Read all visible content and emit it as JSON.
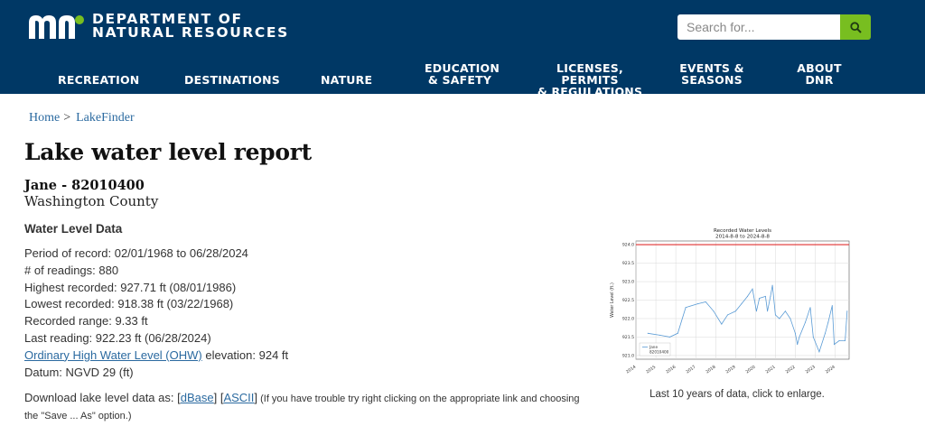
{
  "header": {
    "logo_line1": "DEPARTMENT OF",
    "logo_line2": "NATURAL RESOURCES",
    "search_placeholder": "Search for...",
    "nav": [
      "RECREATION",
      "DESTINATIONS",
      "NATURE",
      "EDUCATION\n& SAFETY",
      "LICENSES, PERMITS\n& REGULATIONS",
      "EVENTS &\nSEASONS",
      "ABOUT\nDNR"
    ]
  },
  "breadcrumb": {
    "home": "Home",
    "sep": ">",
    "current": "LakeFinder"
  },
  "page": {
    "title": "Lake water level report",
    "lake": "Jane - 82010400",
    "county": "Washington County",
    "section_title": "Water Level Data"
  },
  "stats": {
    "period": "Period of record: 02/01/1968 to 06/28/2024",
    "readings": "# of readings: 880",
    "highest": "Highest recorded: 927.71 ft (08/01/1986)",
    "lowest": "Lowest recorded: 918.38 ft (03/22/1968)",
    "range": "Recorded range: 9.33 ft",
    "last": "Last reading: 922.23 ft (06/28/2024)",
    "ohw_link": "Ordinary High Water Level (OHW)",
    "ohw_rest": " elevation: 924 ft",
    "datum": "Datum: NGVD 29 (ft)"
  },
  "download": {
    "prefix": "Download lake level data as: ",
    "dbase": "dBase",
    "ascii": "ASCII",
    "note": " (If you have trouble try right clicking on the appropriate link and choosing the \"Save ... As\" option.)"
  },
  "caption": "Last 10 years of data, click to enlarge.",
  "chart_data": {
    "type": "line",
    "title": "Recorded Water Levels",
    "subtitle": "2014-8-8 to 2024-8-8",
    "ylabel": "Water Level (ft.)",
    "xlabel": "",
    "ylim": [
      920.9,
      924.1
    ],
    "xlim": [
      2014.0,
      2024.7
    ],
    "x_ticks": [
      "2014",
      "2015",
      "2016",
      "2017",
      "2018",
      "2019",
      "2020",
      "2021",
      "2022",
      "2023",
      "2024"
    ],
    "y_ticks": [
      "921.0",
      "921.5",
      "922.0",
      "922.5",
      "923.0",
      "923.5",
      "924.0"
    ],
    "grid": true,
    "legend": {
      "position": "bottom-left",
      "entries": [
        "Jane",
        "82010400"
      ]
    },
    "reference_line": {
      "value": 924.0,
      "color": "#e03030",
      "label": ""
    },
    "series": [
      {
        "name": "Jane",
        "color": "#5a9bd5",
        "x": [
          2014.6,
          2015.2,
          2015.7,
          2016.1,
          2016.5,
          2017.1,
          2017.5,
          2017.9,
          2018.3,
          2018.6,
          2019.0,
          2019.3,
          2019.6,
          2019.85,
          2019.95,
          2020.05,
          2020.2,
          2020.5,
          2020.6,
          2020.75,
          2020.85,
          2021.0,
          2021.2,
          2021.5,
          2021.75,
          2022.0,
          2022.1,
          2022.2,
          2022.5,
          2022.75,
          2022.9,
          2023.2,
          2023.5,
          2023.65,
          2023.85,
          2023.95,
          2024.2,
          2024.5,
          2024.6
        ],
        "y": [
          921.6,
          921.55,
          921.5,
          921.6,
          922.3,
          922.4,
          922.45,
          922.2,
          921.85,
          922.1,
          922.2,
          922.4,
          922.6,
          922.8,
          922.5,
          922.2,
          922.55,
          922.6,
          922.2,
          922.6,
          922.9,
          922.1,
          922.0,
          922.2,
          922.0,
          921.6,
          921.3,
          921.5,
          921.9,
          922.3,
          921.5,
          921.1,
          921.6,
          921.9,
          922.35,
          921.3,
          921.4,
          921.4,
          922.2
        ]
      }
    ]
  }
}
